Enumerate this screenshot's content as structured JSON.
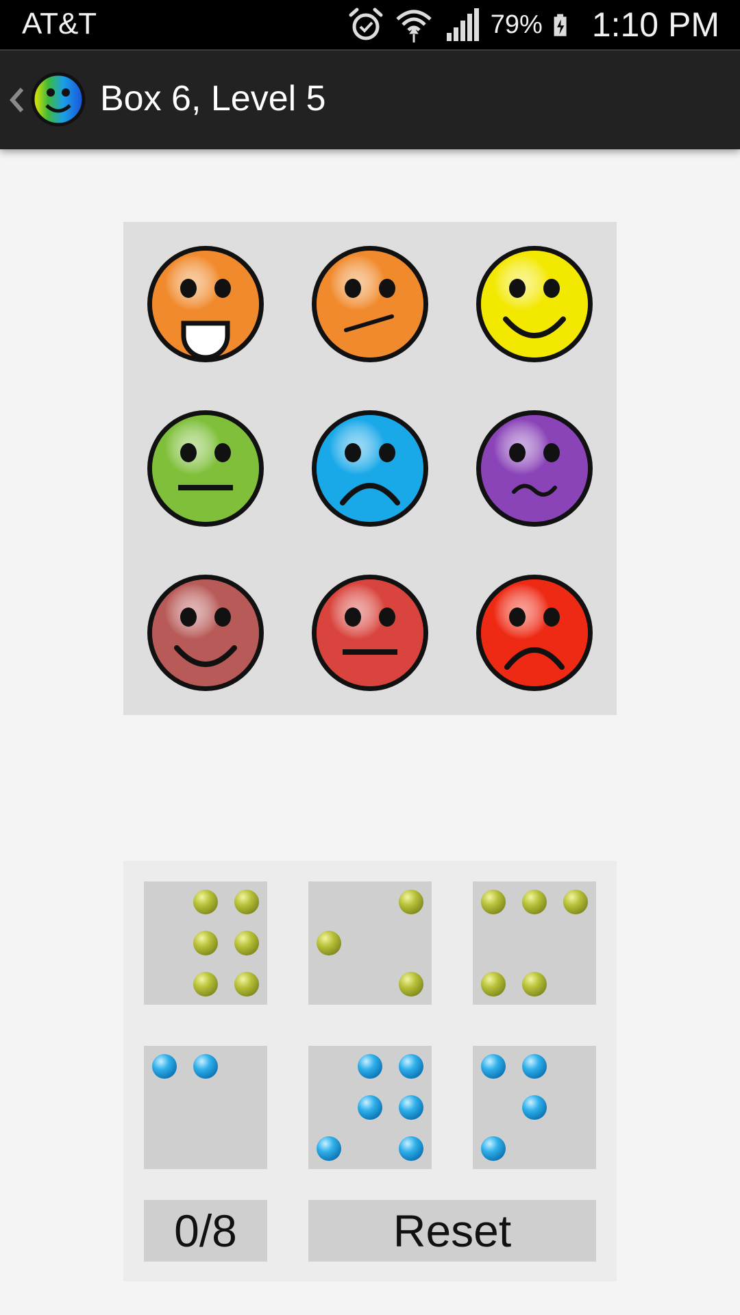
{
  "status_bar": {
    "carrier": "AT&T",
    "battery_percent": "79%",
    "time": "1:10 PM",
    "icons": [
      "alarm-icon",
      "wifi-icon",
      "signal-icon",
      "battery-charging-icon"
    ]
  },
  "action_bar": {
    "title": "Box 6, Level 5",
    "up_icon": "chevron-left-icon",
    "logo_icon": "rainbow-smiley-logo-icon"
  },
  "faces": [
    {
      "color": "#f08a2c",
      "expression": "tongue-out"
    },
    {
      "color": "#f08a2c",
      "expression": "skeptical"
    },
    {
      "color": "#f3e800",
      "expression": "smile"
    },
    {
      "color": "#7fbf3a",
      "expression": "neutral"
    },
    {
      "color": "#19a8e8",
      "expression": "sad"
    },
    {
      "color": "#8a44b8",
      "expression": "wavy"
    },
    {
      "color": "#b85a58",
      "expression": "smile"
    },
    {
      "color": "#d9453e",
      "expression": "neutral"
    },
    {
      "color": "#ee2a14",
      "expression": "sad"
    }
  ],
  "tiles": [
    {
      "color": "olive",
      "dots": [
        [
          1,
          0
        ],
        [
          2,
          0
        ],
        [
          1,
          1
        ],
        [
          2,
          1
        ],
        [
          1,
          2
        ],
        [
          2,
          2
        ]
      ]
    },
    {
      "color": "olive",
      "dots": [
        [
          2,
          0
        ],
        [
          0,
          1
        ],
        [
          2,
          2
        ]
      ]
    },
    {
      "color": "olive",
      "dots": [
        [
          0,
          0
        ],
        [
          1,
          0
        ],
        [
          2,
          0
        ],
        [
          0,
          2
        ],
        [
          1,
          2
        ]
      ]
    },
    {
      "color": "blue",
      "dots": [
        [
          0,
          0
        ],
        [
          1,
          0
        ]
      ]
    },
    {
      "color": "blue",
      "dots": [
        [
          1,
          0
        ],
        [
          2,
          0
        ],
        [
          1,
          1
        ],
        [
          2,
          1
        ],
        [
          0,
          2
        ],
        [
          2,
          2
        ]
      ]
    },
    {
      "color": "blue",
      "dots": [
        [
          0,
          0
        ],
        [
          1,
          0
        ],
        [
          1,
          1
        ],
        [
          0,
          2
        ]
      ]
    }
  ],
  "controls": {
    "counter": "0/8",
    "reset_label": "Reset"
  }
}
